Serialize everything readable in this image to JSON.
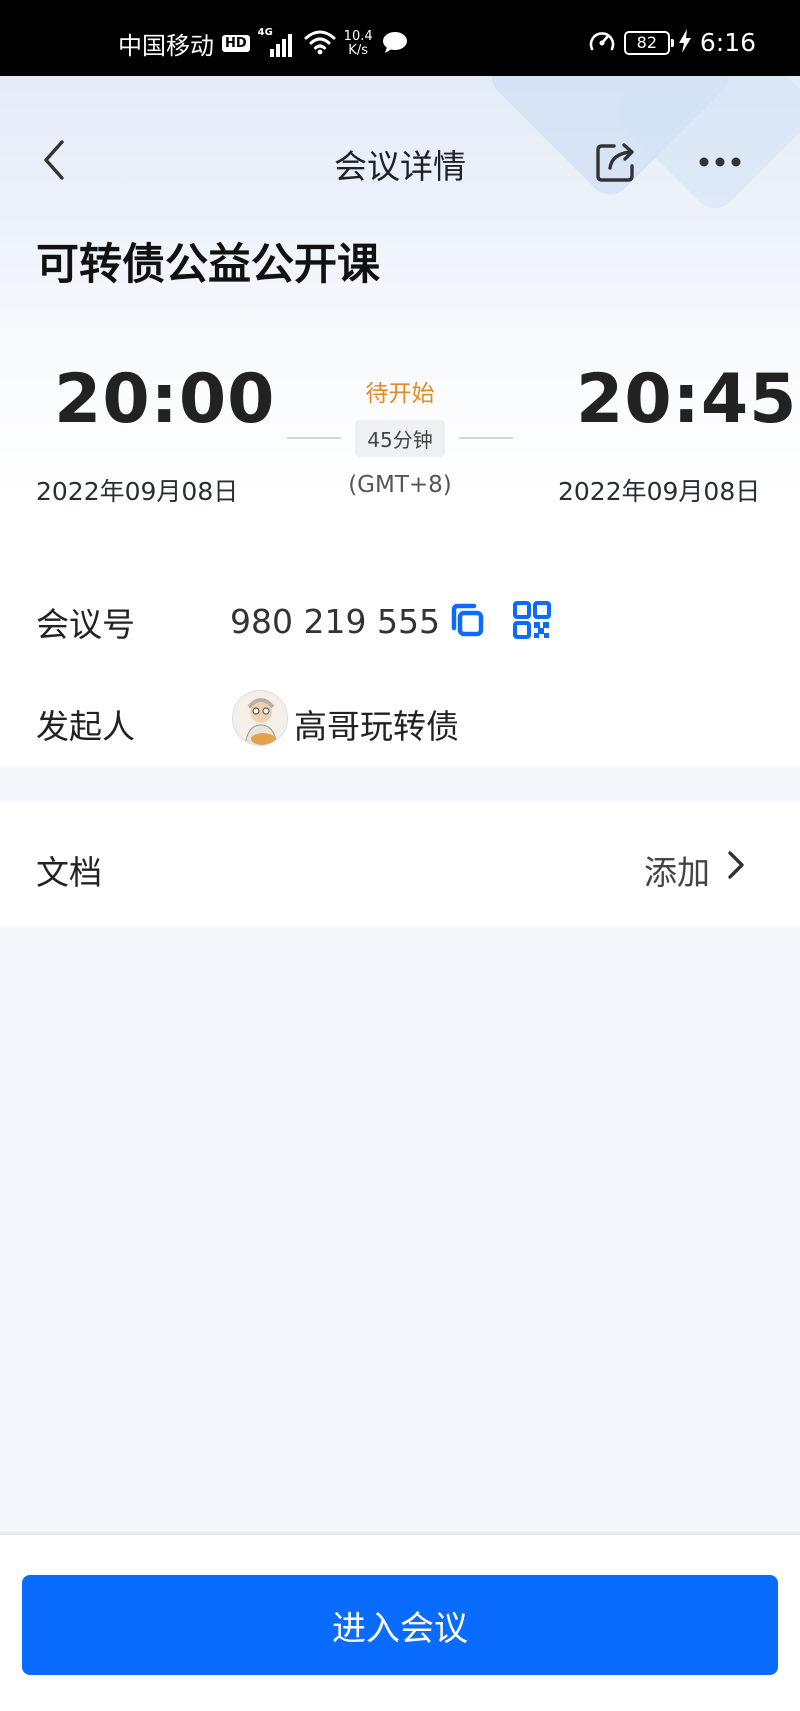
{
  "status_bar": {
    "carrier": "中国移动",
    "hd_badge": "HD",
    "network_type": "4G",
    "net_speed_value": "10.4",
    "net_speed_unit": "K/s",
    "battery": "82",
    "time": "6:16"
  },
  "header": {
    "title": "会议详情"
  },
  "meeting": {
    "title": "可转债公益公开课",
    "start_time": "20:00",
    "start_date": "2022年09月08日",
    "end_time": "20:45",
    "end_date": "2022年09月08日",
    "status": "待开始",
    "duration": "45分钟",
    "timezone": "(GMT+8)",
    "status_color": "#e58a23"
  },
  "info": {
    "meeting_id_label": "会议号",
    "meeting_id": "980 219 555",
    "host_label": "发起人",
    "host_name": "高哥玩转债"
  },
  "docs": {
    "label": "文档",
    "add_label": "添加"
  },
  "footer": {
    "join_label": "进入会议",
    "accent_color": "#0a6cff"
  },
  "icons": [
    "wechat-icon",
    "speed-icon",
    "charging-icon",
    "back-icon",
    "share-icon",
    "more-icon",
    "copy-icon",
    "qr-code-icon",
    "chevron-right-icon"
  ]
}
